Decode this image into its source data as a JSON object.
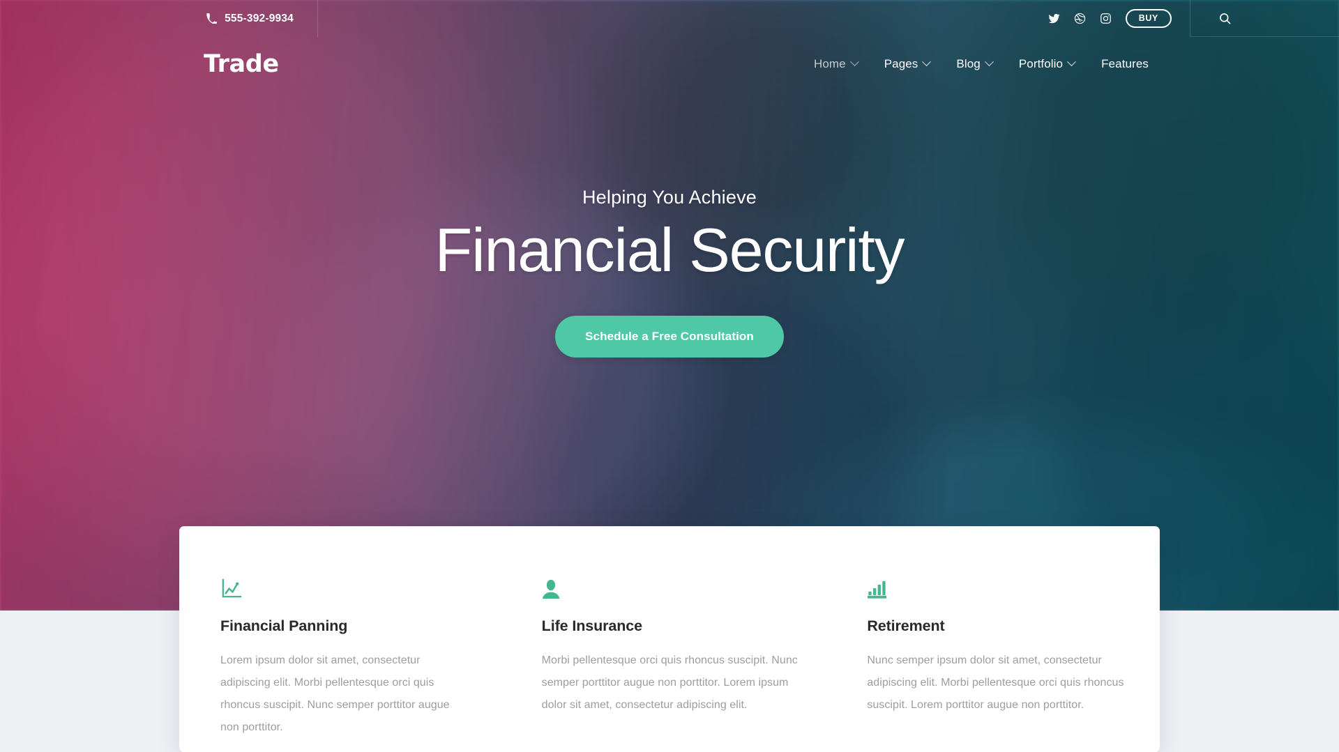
{
  "topbar": {
    "phone_icon": "phone-icon",
    "phone": "555-392-9934",
    "social": [
      {
        "name": "twitter-icon",
        "label": "Twitter"
      },
      {
        "name": "dribbble-icon",
        "label": "Dribbble"
      },
      {
        "name": "instagram-icon",
        "label": "Instagram"
      }
    ],
    "buy_label": "BUY",
    "search_icon": "search-icon"
  },
  "nav": {
    "logo": "Trade",
    "items": [
      {
        "label": "Home",
        "has_dropdown": true,
        "active": true
      },
      {
        "label": "Pages",
        "has_dropdown": true,
        "active": false
      },
      {
        "label": "Blog",
        "has_dropdown": true,
        "active": false
      },
      {
        "label": "Portfolio",
        "has_dropdown": true,
        "active": false
      },
      {
        "label": "Features",
        "has_dropdown": false,
        "active": false
      }
    ]
  },
  "hero": {
    "kicker": "Helping You Achieve",
    "headline": "Financial Security",
    "cta_label": "Schedule a Free Consultation"
  },
  "features": [
    {
      "icon": "line-chart-icon",
      "title": "Financial Panning",
      "body": "Lorem ipsum dolor sit amet, consectetur adipiscing elit. Morbi pellentesque orci quis rhoncus suscipit. Nunc semper porttitor augue non porttitor."
    },
    {
      "icon": "person-icon",
      "title": "Life Insurance",
      "body": "Morbi pellentesque orci quis rhoncus suscipit. Nunc semper porttitor augue non porttitor. Lorem ipsum dolor sit amet, consectetur adipiscing elit."
    },
    {
      "icon": "bar-chart-icon",
      "title": "Retirement",
      "body": "Nunc semper ipsum dolor sit amet, consectetur adipiscing elit. Morbi pellentesque orci quis rhoncus suscipit.  Lorem porttitor augue non porttitor."
    }
  ],
  "colors": {
    "accent_green": "#4fc9a5",
    "gradient_start": "#c02c6e",
    "gradient_end": "#086a7c",
    "page_bg": "#eef1f4",
    "heading": "#27292c",
    "body_text": "#9b9ea3"
  }
}
